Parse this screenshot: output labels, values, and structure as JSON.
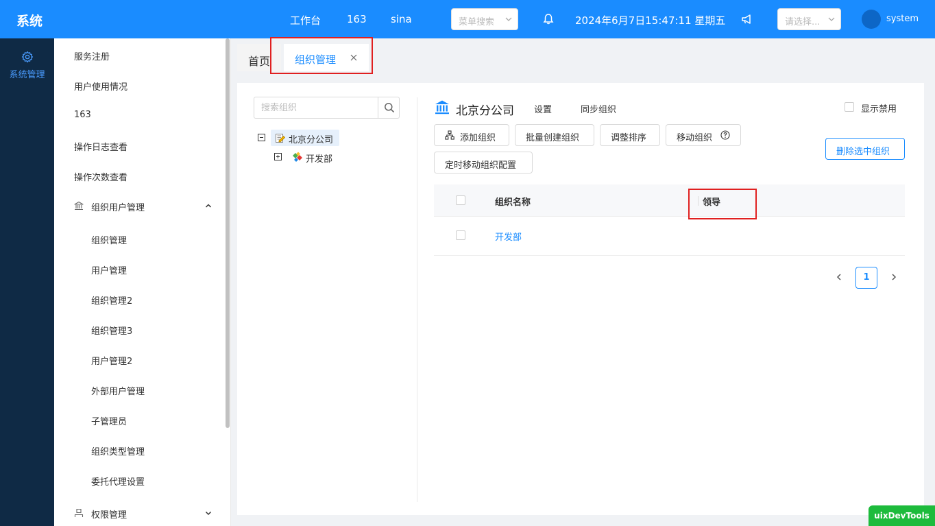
{
  "app": {
    "title": "系统"
  },
  "topnav": {
    "items": [
      "工作台",
      "163",
      "sina"
    ]
  },
  "menu_search": {
    "placeholder": "菜单搜索"
  },
  "datetime": "2024年6月7日15:47:11 星期五",
  "lang_select": {
    "placeholder": "请选择..."
  },
  "user": {
    "name": "system"
  },
  "rail": {
    "item_label": "系统管理",
    "icon": "gear-icon"
  },
  "sidebar": {
    "items": [
      "服务注册",
      "用户使用情况",
      "163",
      "操作日志查看",
      "操作次数查看"
    ],
    "group_org": {
      "label": "组织用户管理",
      "icon": "bank-icon",
      "expanded": true
    },
    "sub_items": [
      "组织管理",
      "用户管理",
      "组织管理2",
      "组织管理3",
      "用户管理2",
      "外部用户管理",
      "子管理员",
      "组织类型管理",
      "委托代理设置"
    ],
    "group_perm": {
      "label": "权限管理",
      "icon": "user-icon",
      "expanded": false
    }
  },
  "tabs": {
    "home": "首页",
    "active": "组织管理"
  },
  "org_search": {
    "placeholder": "搜索组织"
  },
  "tree": {
    "root": "北京分公司",
    "child": "开发部"
  },
  "org_header": {
    "title": "北京分公司",
    "settings": "设置",
    "sync": "同步组织",
    "show_disabled": "显示禁用"
  },
  "toolbar": {
    "add": "添加组织",
    "batch_create": "批量创建组织",
    "reorder": "调整排序",
    "move": "移动组织",
    "scheduled_move": "定时移动组织配置",
    "delete_selected": "删除选中组织"
  },
  "table": {
    "headers": [
      "组织名称",
      "领导"
    ],
    "rows": [
      {
        "name": "开发部",
        "leader": ""
      }
    ]
  },
  "pagination": {
    "current": "1"
  },
  "devtools": {
    "label": "uixDevTools"
  },
  "colors": {
    "primary": "#1a8cff",
    "rail": "#0f2a45",
    "highlight": "#e02020",
    "devtools": "#1dbb3c"
  }
}
